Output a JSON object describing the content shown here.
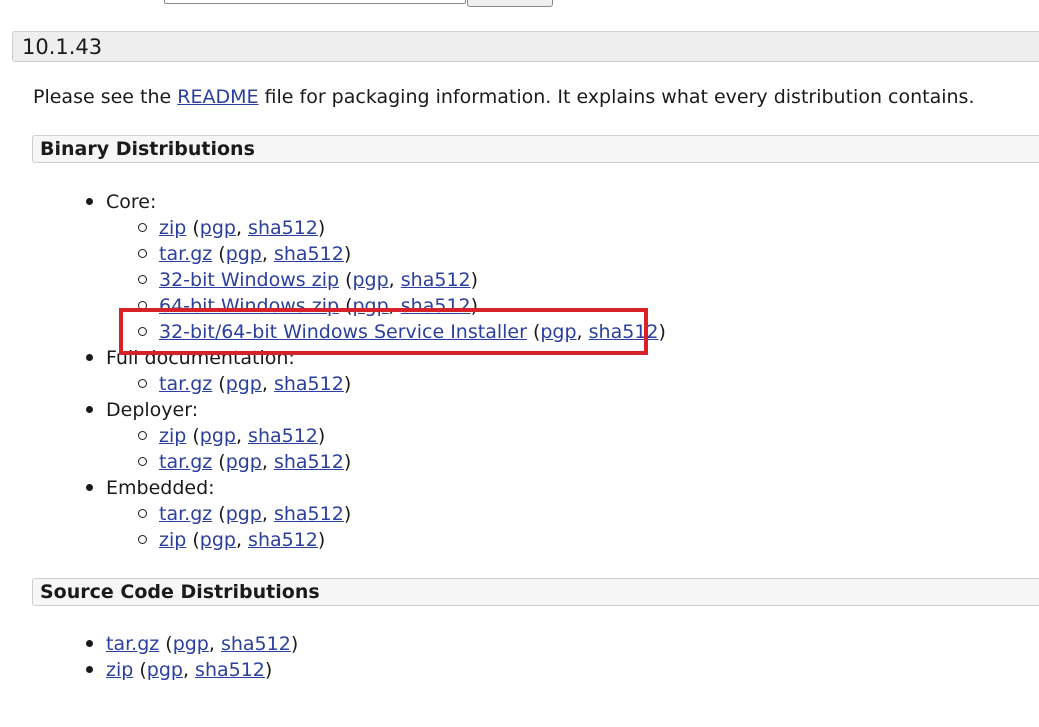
{
  "version": {
    "title": "10.1.43"
  },
  "intro": {
    "before": "Please see the ",
    "link": "README",
    "after": " file for packaging information. It explains what every distribution contains."
  },
  "binary": {
    "title": "Binary Distributions",
    "groups": [
      {
        "label": "Core:",
        "items": [
          {
            "name": "zip",
            "sig": "pgp",
            "hash": "sha512"
          },
          {
            "name": "tar.gz",
            "sig": "pgp",
            "hash": "sha512"
          },
          {
            "name": "32-bit Windows zip",
            "sig": "pgp",
            "hash": "sha512"
          },
          {
            "name": "64-bit Windows zip",
            "sig": "pgp",
            "hash": "sha512"
          },
          {
            "name": "32-bit/64-bit Windows Service Installer",
            "sig": "pgp",
            "hash": "sha512"
          }
        ]
      },
      {
        "label": "Full documentation:",
        "items": [
          {
            "name": "tar.gz",
            "sig": "pgp",
            "hash": "sha512"
          }
        ]
      },
      {
        "label": "Deployer:",
        "items": [
          {
            "name": "zip",
            "sig": "pgp",
            "hash": "sha512"
          },
          {
            "name": "tar.gz",
            "sig": "pgp",
            "hash": "sha512"
          }
        ]
      },
      {
        "label": "Embedded:",
        "items": [
          {
            "name": "tar.gz",
            "sig": "pgp",
            "hash": "sha512"
          },
          {
            "name": "zip",
            "sig": "pgp",
            "hash": "sha512"
          }
        ]
      }
    ]
  },
  "source": {
    "title": "Source Code Distributions",
    "items": [
      {
        "name": "tar.gz",
        "sig": "pgp",
        "hash": "sha512"
      },
      {
        "name": "zip",
        "sig": "pgp",
        "hash": "sha512"
      }
    ]
  },
  "punct": {
    "open": " (",
    "sep": ", ",
    "close": ")"
  },
  "colors": {
    "link": "#2a3f9e",
    "highlight": "#d8222a",
    "bar": "#eeeeee"
  }
}
